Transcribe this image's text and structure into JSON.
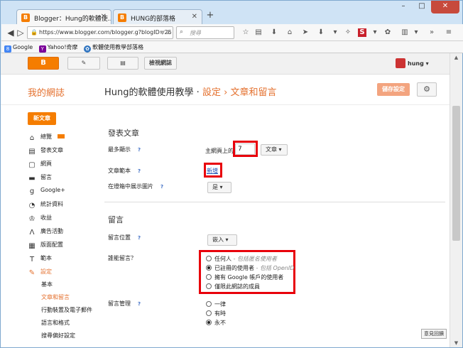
{
  "browser": {
    "tabs": [
      {
        "title": "Blogger：Hung的軟體使...",
        "active": true
      },
      {
        "title": "HUNG的部落格",
        "active": false
      }
    ],
    "new_tab": "+",
    "window_buttons": {
      "minimize": "–",
      "maximize": "□",
      "close": "✕"
    },
    "url": "https://www.blogger.com/blogger.g?blogID=26",
    "search_placeholder": "搜尋",
    "bookmarks": [
      {
        "label": "Google",
        "icon": "google-icon",
        "color": "#4285f4"
      },
      {
        "label": "Yahoo!奇摩",
        "icon": "yahoo-icon",
        "color": "#7b0099"
      },
      {
        "label": "軟體使用教學部落格",
        "icon": "blog-icon",
        "color": "#2f74c0"
      }
    ]
  },
  "topbar": {
    "blogger_label": "B",
    "view_blog": "檢視網誌",
    "user": "hung ▾"
  },
  "header": {
    "my_blogs": "我的網誌",
    "blog_name": "Hung的軟體使用教學",
    "sep1": "·",
    "settings": "設定",
    "sep2": "›",
    "page": "文章和留言",
    "save_button": "儲存設定"
  },
  "sidebar": {
    "new_post": "新文章",
    "items": [
      {
        "label": "總覽",
        "icon": "home-icon",
        "glyph": "⌂"
      },
      {
        "label": "發表文章",
        "icon": "posts-icon",
        "glyph": "▤"
      },
      {
        "label": "網頁",
        "icon": "pages-icon",
        "glyph": "▢"
      },
      {
        "label": "留言",
        "icon": "comments-icon",
        "glyph": "▬"
      },
      {
        "label": "Google+",
        "icon": "googleplus-icon",
        "glyph": "g"
      },
      {
        "label": "統計資料",
        "icon": "stats-icon",
        "glyph": "◔"
      },
      {
        "label": "收益",
        "icon": "earnings-icon",
        "glyph": "♔"
      },
      {
        "label": "廣告活動",
        "icon": "campaigns-icon",
        "glyph": "Λ"
      },
      {
        "label": "版面配置",
        "icon": "layout-icon",
        "glyph": "▦"
      },
      {
        "label": "範本",
        "icon": "template-icon",
        "glyph": "T"
      },
      {
        "label": "設定",
        "icon": "settings-wrench-icon",
        "glyph": "✎"
      }
    ],
    "subitems": [
      "基本",
      "文章和留言",
      "行動裝置及電子郵件",
      "語言和格式",
      "搜尋偏好設定"
    ]
  },
  "posts_section": {
    "title": "發表文章",
    "max_show_label": "最多顯示",
    "homepage_prefix": "主網頁上的",
    "max_show_value": "7",
    "max_show_unit": "文章 ▾",
    "template_label": "文章範本",
    "template_link": "新增",
    "lightbox_label": "在燈箱中展示圖片",
    "lightbox_value": "是 ▾",
    "help": "?"
  },
  "comments_section": {
    "title": "留言",
    "location_label": "留言位置",
    "location_value": "嵌入 ▾",
    "who_label": "誰能留言？",
    "who_options": [
      {
        "label": "任何人",
        "note": " - 包括匿名使用者",
        "checked": false
      },
      {
        "label": "已註冊的使用者",
        "note": " - 包括 OpenID",
        "checked": true
      },
      {
        "label": "擁有 Google 帳戶的使用者",
        "note": "",
        "checked": false
      },
      {
        "label": "僅限此網誌的成員",
        "note": "",
        "checked": false
      }
    ],
    "moderation_label": "留言管理",
    "moderation_options": [
      {
        "label": "一律",
        "checked": false
      },
      {
        "label": "有時",
        "checked": false
      },
      {
        "label": "永不",
        "checked": true
      }
    ]
  },
  "feedback": "意見回饋",
  "colors": {
    "accent": "#f57d00",
    "highlight": "#e8000b",
    "link": "#1a4fb5"
  }
}
